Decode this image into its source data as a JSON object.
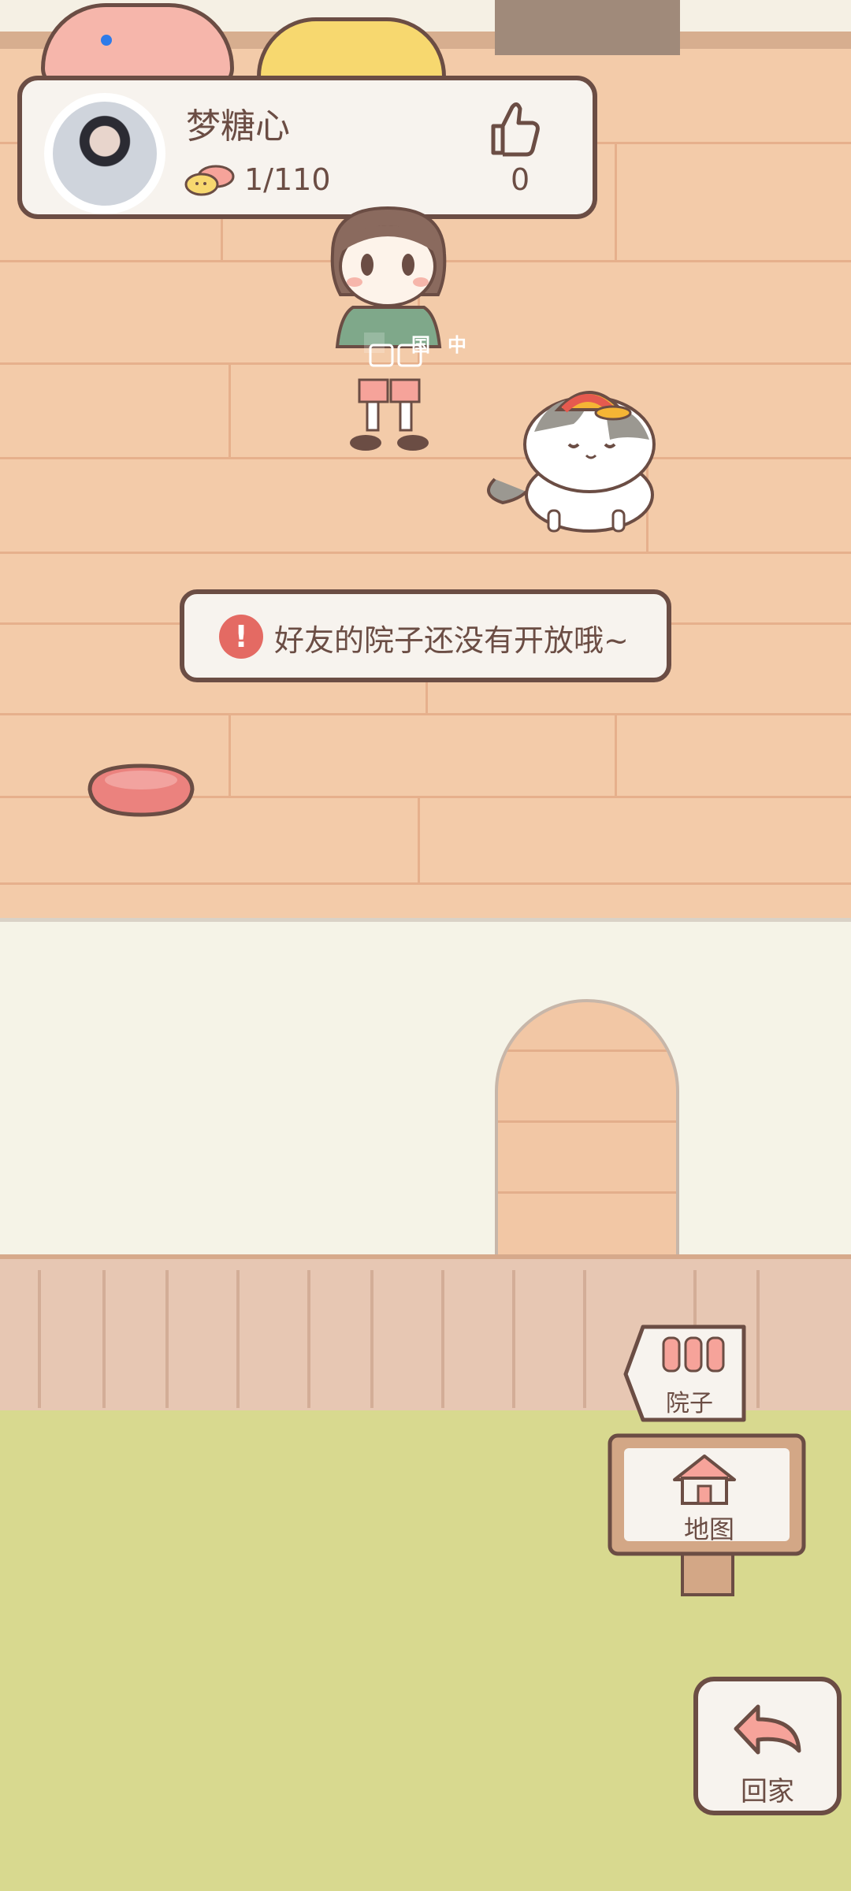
{
  "profile": {
    "username": "梦糖心",
    "fish_count": "1/110",
    "like_count": "0"
  },
  "toast": {
    "message": "好友的院子还没有开放哦~"
  },
  "girl_jacket_text": [
    "国",
    "中"
  ],
  "buttons": {
    "yard_label": "院子",
    "map_label": "地图",
    "home_label": "回家"
  },
  "colors": {
    "outline": "#6b4d44",
    "floor": "#f3cba9",
    "wall": "#f5f3e7",
    "grass": "#d8d98f",
    "accent_pink": "#f6b6ab",
    "alert": "#e46a63"
  },
  "icons": [
    "fish-icon",
    "thumbs-up-icon",
    "alert-icon",
    "gate-icon",
    "house-icon",
    "return-arrow-icon"
  ]
}
